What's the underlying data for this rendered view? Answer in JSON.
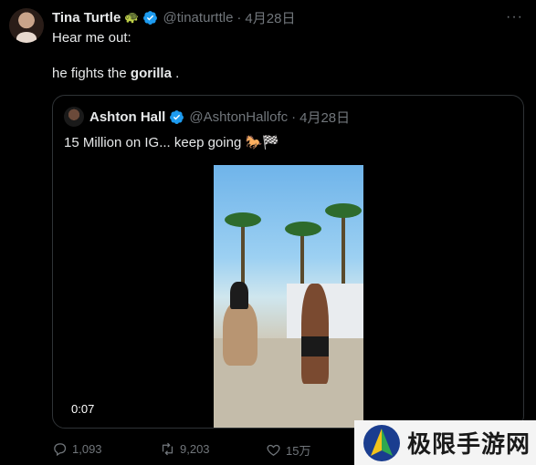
{
  "tweet": {
    "author_name": "Tina Turtle",
    "author_emoji": "🐢",
    "handle": "@tinaturttle",
    "separator": "·",
    "time": "4月28日",
    "line1": "Hear me out:",
    "line2_prefix": "he fights the ",
    "line2_bold": "gorilla",
    "line2_suffix": " .",
    "more": "···"
  },
  "quote": {
    "author_name": "Ashton Hall",
    "handle": "@AshtonHallofc",
    "separator": "·",
    "time": "4月28日",
    "text": "15 Million on IG... keep going 🐎🏁",
    "video_duration": "0:07"
  },
  "actions": {
    "replies": "1,093",
    "retweets": "9,203",
    "likes": "15万"
  },
  "watermark": {
    "text": "极限手游网"
  },
  "colors": {
    "background": "#000000",
    "text": "#e7e9ea",
    "muted": "#71767b",
    "verified": "#1d9bf0",
    "border": "#2f3336"
  }
}
